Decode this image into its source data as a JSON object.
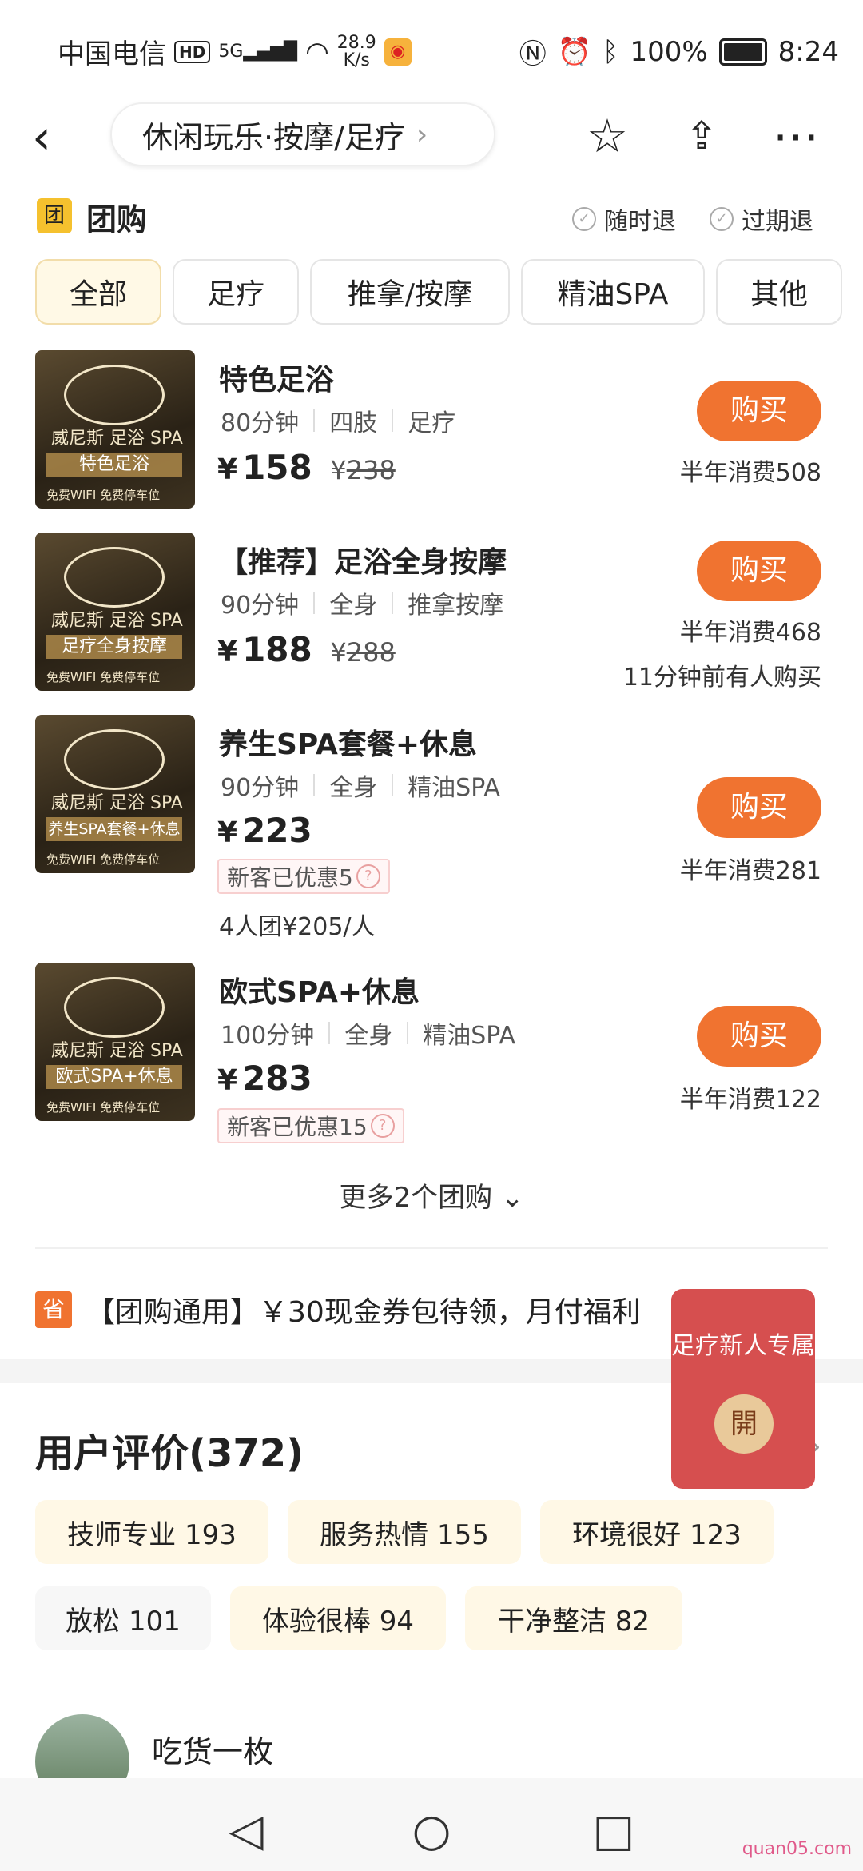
{
  "status_bar": {
    "carrier": "中国电信",
    "hd": "HD",
    "signal": "5G",
    "speed_value": "28.9",
    "speed_unit": "K/s",
    "battery": "100%",
    "time": "8:24"
  },
  "header": {
    "breadcrumb": "休闲玩乐·按摩/足疗"
  },
  "groupbuy": {
    "badge": "团",
    "title": "团购",
    "policy_1": "随时退",
    "policy_2": "过期退"
  },
  "filters": [
    "全部",
    "足疗",
    "推拿/按摩",
    "精油SPA",
    "其他"
  ],
  "thumb_common": {
    "brand": "威尼斯 足浴 SPA",
    "footer": "免费WIFI   免费停车位"
  },
  "deals": [
    {
      "thumb_caption": "特色足浴",
      "name": "特色足浴",
      "tags": [
        "80分钟",
        "四肢",
        "足疗"
      ],
      "currency": "¥",
      "price": "158",
      "original_price": "238",
      "buy_label": "购买",
      "sales": "半年消费508"
    },
    {
      "thumb_caption": "足疗全身按摩",
      "name": "【推荐】足浴全身按摩",
      "tags": [
        "90分钟",
        "全身",
        "推拿按摩"
      ],
      "currency": "¥",
      "price": "188",
      "original_price": "288",
      "buy_label": "购买",
      "sales": "半年消费468",
      "recent": "11分钟前有人购买"
    },
    {
      "thumb_caption": "养生SPA套餐+休息",
      "name": "养生SPA套餐+休息",
      "tags": [
        "90分钟",
        "全身",
        "精油SPA"
      ],
      "currency": "¥",
      "price": "223",
      "new_customer": "新客已优惠5",
      "group_offer": "4人团¥205/人",
      "buy_label": "购买",
      "sales": "半年消费281"
    },
    {
      "thumb_caption": "欧式SPA+休息",
      "name": "欧式SPA+休息",
      "tags": [
        "100分钟",
        "全身",
        "精油SPA"
      ],
      "currency": "¥",
      "price": "283",
      "new_customer": "新客已优惠15",
      "buy_label": "购买",
      "sales": "半年消费122"
    }
  ],
  "more_link": "更多2个团购",
  "promo": {
    "icon": "省",
    "text": "【团购通用】￥30现金券包待领，月付福利"
  },
  "floating_badge": {
    "text": "足疗新人专属",
    "open": "開"
  },
  "reviews": {
    "title": "用户评价(372)",
    "chips": [
      "技师专业 193",
      "服务热情 155",
      "环境很好 123",
      "放松 101",
      "体验很棒 94",
      "干净整洁 82"
    ]
  },
  "review_user": {
    "name": "吃货一枚"
  },
  "watermark": "quan05.com",
  "colors": {
    "accent": "#f07330",
    "badge_yellow": "#f5c12e",
    "chip_bg": "#fff8e6",
    "float_red": "#d64f4f"
  }
}
